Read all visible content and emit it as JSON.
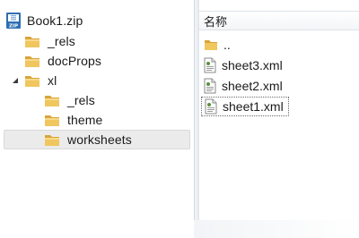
{
  "tree": {
    "root": {
      "label": "Book1.zip",
      "icon": "zip-archive-icon"
    },
    "items": [
      {
        "label": "_rels",
        "icon": "folder-icon"
      },
      {
        "label": "docProps",
        "icon": "folder-icon"
      },
      {
        "label": "xl",
        "icon": "folder-icon",
        "expanded": true
      },
      {
        "label": "_rels",
        "icon": "folder-icon"
      },
      {
        "label": "theme",
        "icon": "folder-icon"
      },
      {
        "label": "worksheets",
        "icon": "folder-icon",
        "selected": true
      }
    ]
  },
  "list": {
    "column_header": "名称",
    "items": [
      {
        "label": "..",
        "icon": "folder-icon"
      },
      {
        "label": "sheet3.xml",
        "icon": "xml-file-icon"
      },
      {
        "label": "sheet2.xml",
        "icon": "xml-file-icon"
      },
      {
        "label": "sheet1.xml",
        "icon": "xml-file-icon",
        "focused": true
      }
    ]
  },
  "colors": {
    "folder": "#e8b64a",
    "selection": "#ebebeb",
    "header_border": "#dde3ea"
  }
}
